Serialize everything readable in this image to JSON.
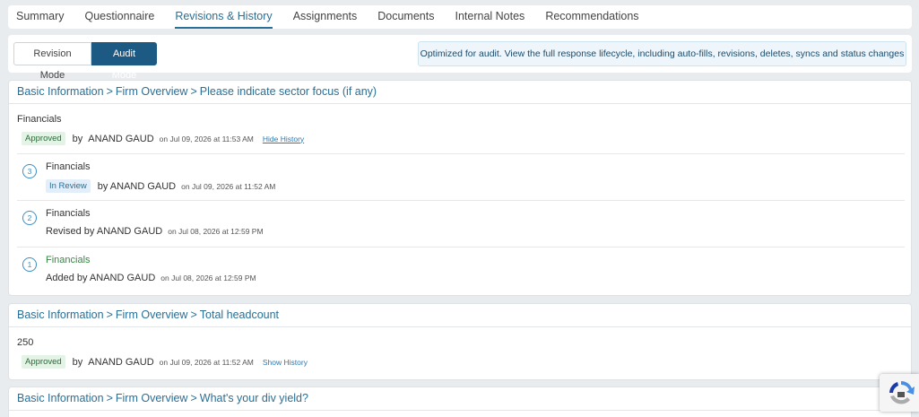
{
  "tabs": [
    "Summary",
    "Questionnaire",
    "Revisions & History",
    "Assignments",
    "Documents",
    "Internal Notes",
    "Recommendations"
  ],
  "mode": {
    "revision_label": "Revision Mode",
    "audit_label": "Audit Mode",
    "info": "Optimized for audit. View the full response lifecycle, including auto-fills, revisions, deletes, syncs and status changes"
  },
  "cards": [
    {
      "crumbs": [
        "Basic Information",
        "Firm Overview",
        "Please indicate sector focus (if any)"
      ],
      "answer": "Financials",
      "status": "Approved",
      "by": "by",
      "user": "ANAND GAUD",
      "when": "on Jul 09, 2026 at 11:53 AM",
      "history_link": "Hide History",
      "revisions": [
        {
          "num": "3",
          "value": "Financials",
          "status": "In Review",
          "action": "by ANAND GAUD",
          "when": "on Jul 09, 2026 at 11:52 AM"
        },
        {
          "num": "2",
          "value": "Financials",
          "action": "Revised by ANAND GAUD",
          "when": "on Jul 08, 2026 at 12:59 PM"
        },
        {
          "num": "1",
          "value": "Financials",
          "action": "Added by ANAND GAUD",
          "when": "on Jul 08, 2026 at 12:59 PM"
        }
      ]
    },
    {
      "crumbs": [
        "Basic Information",
        "Firm Overview",
        "Total headcount"
      ],
      "answer": "250",
      "status": "Approved",
      "by": "by",
      "user": "ANAND GAUD",
      "when": "on Jul 09, 2026 at 11:52 AM",
      "history_link": "Show History"
    },
    {
      "crumbs": [
        "Basic Information",
        "Firm Overview",
        "What's your div yield?"
      ]
    }
  ],
  "colors": {
    "accent": "#2a6f96",
    "active_button": "#1c5a84",
    "added_value": "#2e8b3e"
  }
}
